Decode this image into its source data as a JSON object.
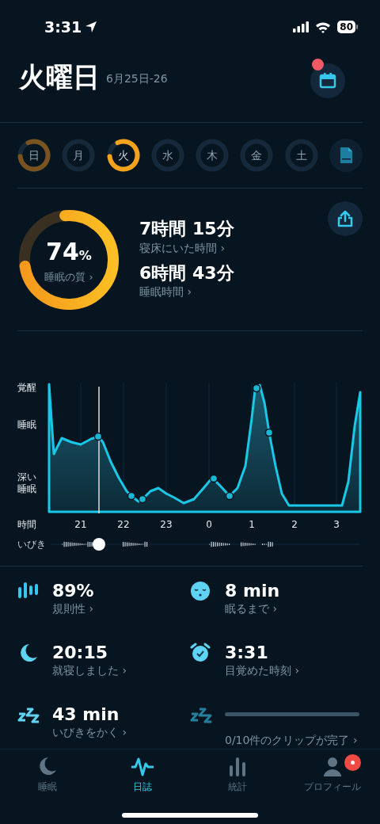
{
  "status_bar": {
    "time": "3:31",
    "battery": "80"
  },
  "header": {
    "title": "火曜日",
    "date_range": "6月25日-26",
    "calendar_badge": true
  },
  "days": [
    {
      "label": "日",
      "selected": false,
      "has_data": true
    },
    {
      "label": "月",
      "selected": false,
      "has_data": false
    },
    {
      "label": "火",
      "selected": true,
      "has_data": true
    },
    {
      "label": "水",
      "selected": false,
      "has_data": false
    },
    {
      "label": "木",
      "selected": false,
      "has_data": false
    },
    {
      "label": "金",
      "selected": false,
      "has_data": false
    },
    {
      "label": "土",
      "selected": false,
      "has_data": false
    }
  ],
  "quality": {
    "value": "74",
    "unit": "%",
    "label": "睡眠の質 ›"
  },
  "durations": [
    {
      "value": "7時間 15分",
      "label": "寝床にいた時間 ›"
    },
    {
      "value": "6時間 43分",
      "label": "睡眠時間 ›"
    }
  ],
  "chart": {
    "y_labels": [
      "覚醒",
      "睡眠",
      "深い睡眠"
    ],
    "x_title": "時間",
    "x_labels": [
      "21",
      "22",
      "23",
      "0",
      "1",
      "2",
      "3"
    ],
    "snore_label": "いびき"
  },
  "stats": [
    {
      "kind": "metric",
      "value": "89%",
      "label": "規則性 ›"
    },
    {
      "kind": "metric",
      "value": "8 min",
      "label": "眠るまで ›"
    },
    {
      "kind": "metric",
      "value": "20:15",
      "label": "就寝しました ›"
    },
    {
      "kind": "metric",
      "value": "3:31",
      "label": "目覚めた時刻 ›"
    },
    {
      "kind": "metric",
      "value": "43 min",
      "label": "いびきをかく ›"
    },
    {
      "kind": "progress",
      "level": 0,
      "label": "0/10件のクリップが完了 ›"
    }
  ],
  "tabs": [
    {
      "label": "睡眠",
      "selected": false,
      "badge": false
    },
    {
      "label": "日誌",
      "selected": true,
      "badge": false
    },
    {
      "label": "統計",
      "selected": false,
      "badge": false
    },
    {
      "label": "プロフィール",
      "selected": false,
      "badge": true
    }
  ]
}
